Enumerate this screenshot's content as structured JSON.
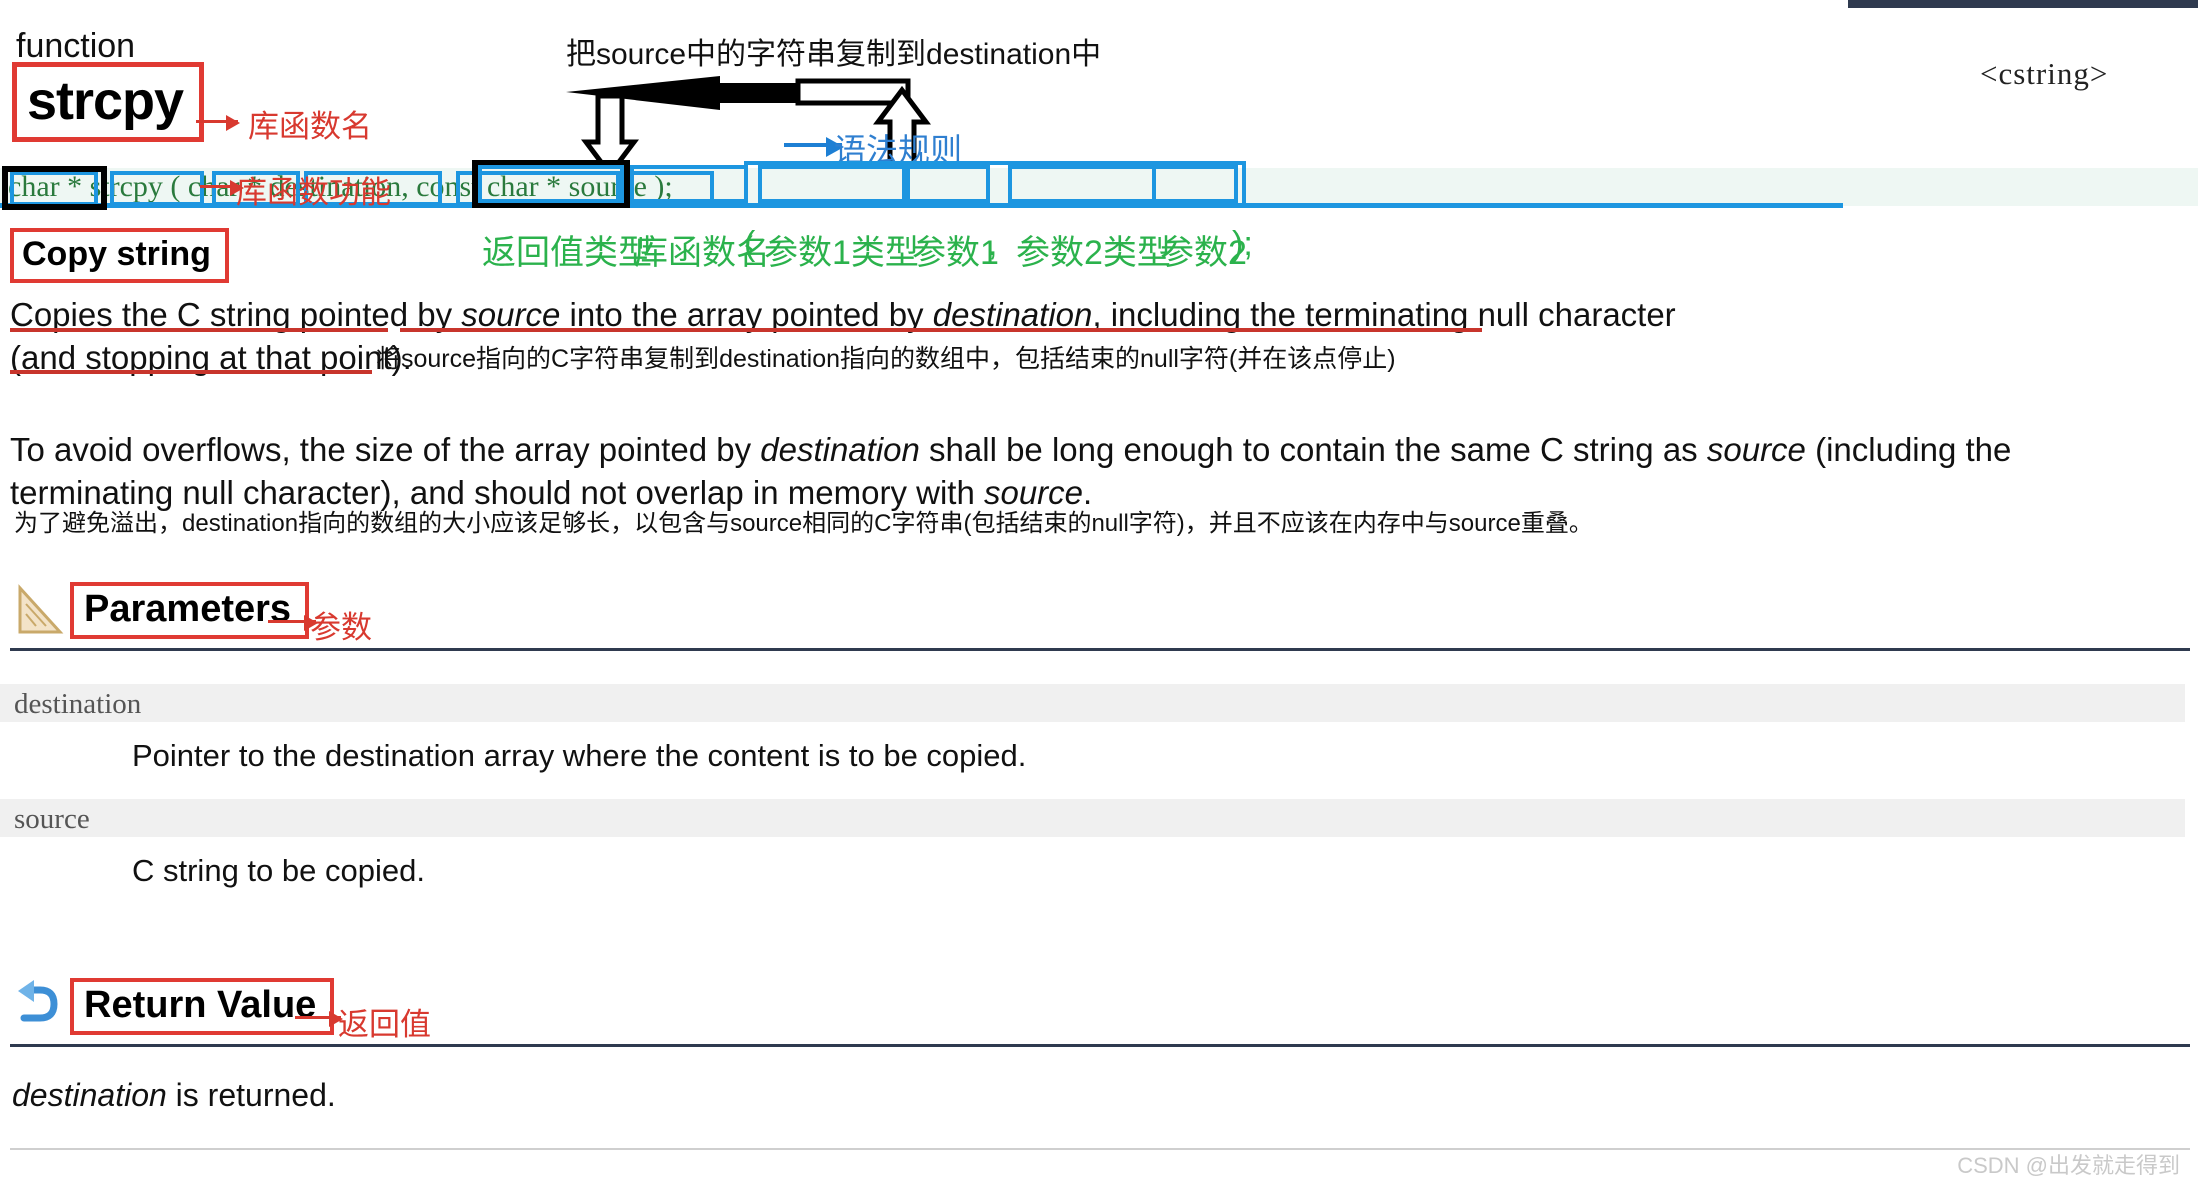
{
  "header": {
    "kind": "function",
    "name": "strcpy",
    "include": "<cstring>",
    "name_note": "库函数名",
    "summary": "Copy string",
    "summary_note": "库函数功能"
  },
  "top_annotation": {
    "text": "把source中的字符串复制到destination中"
  },
  "syntax": {
    "tokens": [
      {
        "t": "char *",
        "box": "black-blue"
      },
      {
        "t": "strcpy",
        "box": "blue"
      },
      {
        "t": " (",
        "box": "none"
      },
      {
        "t": "char *",
        "box": "blue"
      },
      {
        "t": "destination",
        "box": "blue"
      },
      {
        "t": ", ",
        "box": "none"
      },
      {
        "t": "const char *",
        "box": "blue"
      },
      {
        "t": "source",
        "box": "blue"
      },
      {
        "t": ");",
        "box": "none"
      }
    ],
    "full": "char * strcpy ( char * destination, const char * source );",
    "note": "语法规则",
    "schema": {
      "return_type": "返回值类型",
      "func_name": "库函数名",
      "open_paren": "(",
      "param1_type": "参数1类型",
      "param1": "参数1",
      "comma": ",",
      "param2_type": "参数2类型",
      "param2": "参数2",
      "close": ");"
    }
  },
  "description": {
    "line1": "Copies the C string pointed by ",
    "line1_em1": "source",
    "line1_mid": " into the array pointed by ",
    "line1_em2": "destination",
    "line1_end": ", including the terminating null character",
    "line2": "(and stopping at that point).",
    "line2_cn": "将source指向的C字符串复制到destination指向的数组中，包括结束的null字符(并在该点停止)",
    "para2_a": "To avoid overflows, the size of the array pointed by ",
    "para2_em1": "destination",
    "para2_b": " shall be long enough to contain the same C string as",
    "para2_em2": "source",
    "para2_c": " (including the terminating null character), and should not overlap in memory with ",
    "para2_em3": "source",
    "para2_d": ".",
    "para2_cn": "为了避免溢出，destination指向的数组的大小应该足够长，以包含与source相同的C字符串(包括结束的null字符)，并且不应该在内存中与source重叠。"
  },
  "parameters": {
    "heading": "Parameters",
    "heading_note": "参数",
    "icon": "ruler-triangle-icon",
    "items": [
      {
        "name": "destination",
        "desc": "Pointer to the destination array where the content is to be copied."
      },
      {
        "name": "source",
        "desc": "C string to be copied."
      }
    ]
  },
  "return_value": {
    "heading": "Return Value",
    "heading_note": "返回值",
    "icon": "return-arrow-icon",
    "text_em": "destination",
    "text_rest": " is returned."
  },
  "watermark": "CSDN @出发就走得到",
  "colors": {
    "red": "#d8392f",
    "blue": "#1d96e0",
    "green": "#2a7a3d",
    "cn_green": "#2bb24c",
    "rule": "#2f3a4f",
    "band": "#eef7f3"
  }
}
